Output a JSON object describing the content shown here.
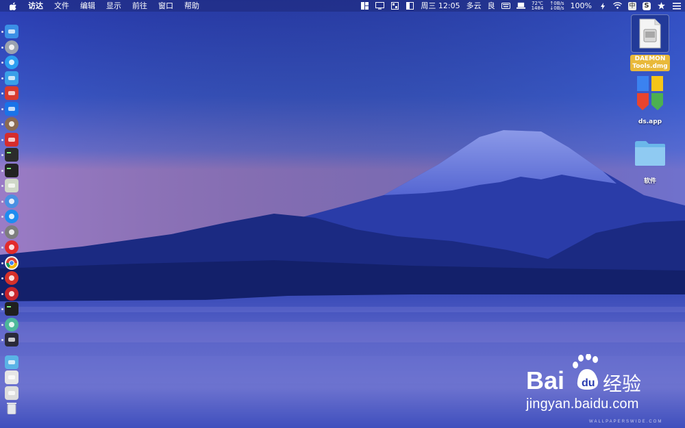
{
  "menubar": {
    "apple_icon": "apple-logo-icon",
    "items": [
      "访达",
      "文件",
      "编辑",
      "显示",
      "前往",
      "窗口",
      "帮助"
    ],
    "status": {
      "datetime": "周三 12:05",
      "weather": "多云",
      "air_quality": "良",
      "temperature": "72℃",
      "fan_speed": "1484",
      "net_up": "↑0B/s",
      "net_down": "↓0B/s",
      "battery": "100%",
      "ime": "中",
      "s_app": "S"
    }
  },
  "dock": {
    "items": [
      {
        "name": "finder",
        "color": "#3b8fe6"
      },
      {
        "name": "launchpad",
        "color": "#9aa2b0"
      },
      {
        "name": "safari",
        "color": "#2b9ef0"
      },
      {
        "name": "contacts",
        "color": "#3aa0e8"
      },
      {
        "name": "red-app",
        "color": "#d83a2e"
      },
      {
        "name": "teamviewer",
        "color": "#1a73e8"
      },
      {
        "name": "basketball",
        "color": "#8a6a52"
      },
      {
        "name": "istat-menus",
        "color": "#d62c2c"
      },
      {
        "name": "activity-monitor",
        "color": "#2b2b2b"
      },
      {
        "name": "terminal",
        "color": "#222222"
      },
      {
        "name": "preview",
        "color": "#cfd8c8"
      },
      {
        "name": "siri",
        "color": "#4a90e2"
      },
      {
        "name": "app-store",
        "color": "#1e8cf0"
      },
      {
        "name": "system-preferences",
        "color": "#7d7d7d"
      },
      {
        "name": "yandex",
        "color": "#e22b2b"
      },
      {
        "name": "chrome",
        "color": "#f3f3f3"
      },
      {
        "name": "netease-music",
        "color": "#d6312a"
      },
      {
        "name": "vivaldi",
        "color": "#c7252c"
      },
      {
        "name": "iterm",
        "color": "#1f1f1f"
      },
      {
        "name": "pixel-app",
        "color": "#4db89a"
      },
      {
        "name": "eye-app",
        "color": "#2a2a3a"
      },
      {
        "name": "downloads-folder",
        "color": "#5ab3e6"
      },
      {
        "name": "screenshot-doc",
        "color": "#e6e6e6"
      },
      {
        "name": "phone-doc",
        "color": "#dddddd"
      },
      {
        "name": "trash",
        "color": "#cfd3da"
      }
    ]
  },
  "desktop": {
    "icons": [
      {
        "label_line1": "DAEMON",
        "label_line2": "Tools.dmg"
      },
      {
        "label": "ds.app"
      },
      {
        "label": "软件"
      }
    ]
  },
  "watermark": {
    "brand": "Bai",
    "cn": "经验",
    "url": "jingyan.baidu.com",
    "small": "WALLPAPERSWIDE.COM"
  }
}
